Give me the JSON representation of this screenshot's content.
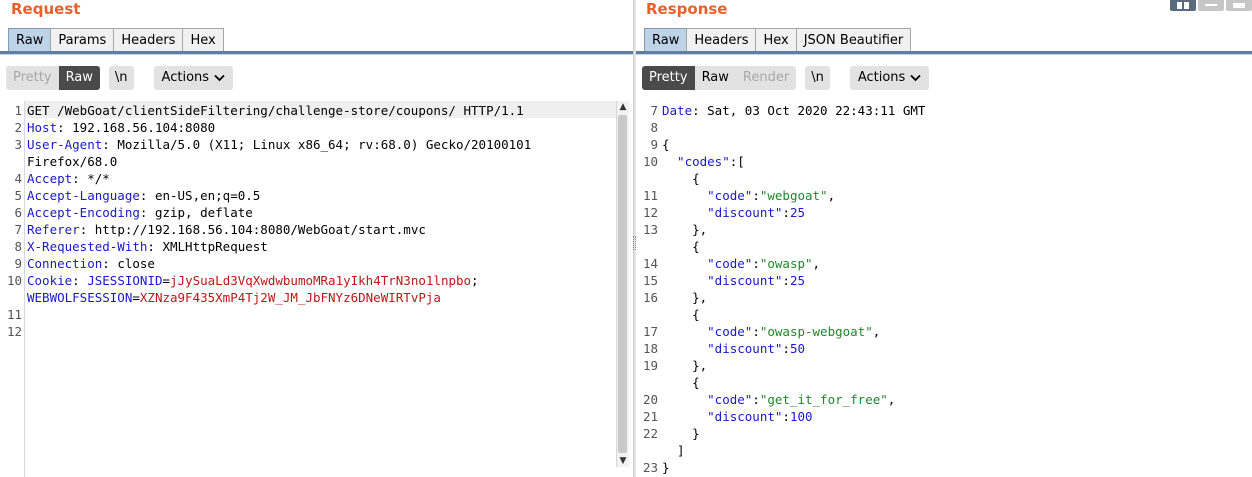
{
  "request": {
    "title": "Request",
    "tabs": [
      "Raw",
      "Params",
      "Headers",
      "Hex"
    ],
    "active_tab": "Raw",
    "view_modes": [
      "Pretty",
      "Raw"
    ],
    "newline_label": "\\n",
    "actions_label": "Actions",
    "lines": [
      {
        "n": "1",
        "parts": [
          {
            "t": "GET /WebGoat/clientSideFiltering/challenge-store/coupons/ HTTP/1.1",
            "c": ""
          }
        ]
      },
      {
        "n": "2",
        "parts": [
          {
            "t": "Host",
            "c": "k"
          },
          {
            "t": ": 192.168.56.104:8080",
            "c": ""
          }
        ]
      },
      {
        "n": "3",
        "parts": [
          {
            "t": "User-Agent",
            "c": "k"
          },
          {
            "t": ": Mozilla/5.0 (X11; Linux x86_64; rv:68.0) Gecko/20100101",
            "c": ""
          }
        ]
      },
      {
        "n": "",
        "parts": [
          {
            "t": "Firefox/68.0",
            "c": ""
          }
        ]
      },
      {
        "n": "4",
        "parts": [
          {
            "t": "Accept",
            "c": "k"
          },
          {
            "t": ": */*",
            "c": ""
          }
        ]
      },
      {
        "n": "5",
        "parts": [
          {
            "t": "Accept-Language",
            "c": "k"
          },
          {
            "t": ": en-US,en;q=0.5",
            "c": ""
          }
        ]
      },
      {
        "n": "6",
        "parts": [
          {
            "t": "Accept-Encoding",
            "c": "k"
          },
          {
            "t": ": gzip, deflate",
            "c": ""
          }
        ]
      },
      {
        "n": "7",
        "parts": [
          {
            "t": "Referer",
            "c": "k"
          },
          {
            "t": ": http://192.168.56.104:8080/WebGoat/start.mvc",
            "c": ""
          }
        ]
      },
      {
        "n": "8",
        "parts": [
          {
            "t": "X-Requested-With",
            "c": "k"
          },
          {
            "t": ": XMLHttpRequest",
            "c": ""
          }
        ]
      },
      {
        "n": "9",
        "parts": [
          {
            "t": "Connection",
            "c": "k"
          },
          {
            "t": ": close",
            "c": ""
          }
        ]
      },
      {
        "n": "10",
        "parts": [
          {
            "t": "Cookie",
            "c": "k"
          },
          {
            "t": ": ",
            "c": ""
          },
          {
            "t": "JSESSIONID",
            "c": "k"
          },
          {
            "t": "=",
            "c": ""
          },
          {
            "t": "jJySuaLd3VqXwdwbumoMRa1yIkh4TrN3no1lnpbo",
            "c": "v"
          },
          {
            "t": ";",
            "c": ""
          }
        ]
      },
      {
        "n": "",
        "parts": [
          {
            "t": "WEBWOLFSESSION",
            "c": "k"
          },
          {
            "t": "=",
            "c": ""
          },
          {
            "t": "XZNza9F435XmP4Tj2W_JM_JbFNYz6DNeWIRTvPja",
            "c": "v"
          }
        ]
      },
      {
        "n": "11",
        "parts": []
      },
      {
        "n": "12",
        "parts": []
      }
    ]
  },
  "response": {
    "title": "Response",
    "tabs": [
      "Raw",
      "Headers",
      "Hex",
      "JSON Beautifier"
    ],
    "active_tab": "Raw",
    "view_modes": [
      "Pretty",
      "Raw",
      "Render"
    ],
    "newline_label": "\\n",
    "actions_label": "Actions",
    "lines": [
      {
        "n": "7",
        "parts": [
          {
            "t": "Date",
            "c": "k"
          },
          {
            "t": ": Sat, 03 Oct 2020 22:43:11 GMT",
            "c": ""
          }
        ]
      },
      {
        "n": "8",
        "parts": []
      },
      {
        "n": "9",
        "parts": [
          {
            "t": "{",
            "c": ""
          }
        ]
      },
      {
        "n": "10",
        "parts": [
          {
            "t": "  \"codes\"",
            "c": "k"
          },
          {
            "t": ":[",
            "c": ""
          }
        ]
      },
      {
        "n": "",
        "parts": [
          {
            "t": "    {",
            "c": ""
          }
        ]
      },
      {
        "n": "11",
        "parts": [
          {
            "t": "      \"code\"",
            "c": "k"
          },
          {
            "t": ":",
            "c": ""
          },
          {
            "t": "\"webgoat\"",
            "c": "s"
          },
          {
            "t": ",",
            "c": ""
          }
        ]
      },
      {
        "n": "12",
        "parts": [
          {
            "t": "      \"discount\"",
            "c": "k"
          },
          {
            "t": ":",
            "c": ""
          },
          {
            "t": "25",
            "c": "n"
          }
        ]
      },
      {
        "n": "13",
        "parts": [
          {
            "t": "    },",
            "c": ""
          }
        ]
      },
      {
        "n": "",
        "parts": [
          {
            "t": "    {",
            "c": ""
          }
        ]
      },
      {
        "n": "14",
        "parts": [
          {
            "t": "      \"code\"",
            "c": "k"
          },
          {
            "t": ":",
            "c": ""
          },
          {
            "t": "\"owasp\"",
            "c": "s"
          },
          {
            "t": ",",
            "c": ""
          }
        ]
      },
      {
        "n": "15",
        "parts": [
          {
            "t": "      \"discount\"",
            "c": "k"
          },
          {
            "t": ":",
            "c": ""
          },
          {
            "t": "25",
            "c": "n"
          }
        ]
      },
      {
        "n": "16",
        "parts": [
          {
            "t": "    },",
            "c": ""
          }
        ]
      },
      {
        "n": "",
        "parts": [
          {
            "t": "    {",
            "c": ""
          }
        ]
      },
      {
        "n": "17",
        "parts": [
          {
            "t": "      \"code\"",
            "c": "k"
          },
          {
            "t": ":",
            "c": ""
          },
          {
            "t": "\"owasp-webgoat\"",
            "c": "s"
          },
          {
            "t": ",",
            "c": ""
          }
        ]
      },
      {
        "n": "18",
        "parts": [
          {
            "t": "      \"discount\"",
            "c": "k"
          },
          {
            "t": ":",
            "c": ""
          },
          {
            "t": "50",
            "c": "n"
          }
        ]
      },
      {
        "n": "19",
        "parts": [
          {
            "t": "    },",
            "c": ""
          }
        ]
      },
      {
        "n": "",
        "parts": [
          {
            "t": "    {",
            "c": ""
          }
        ]
      },
      {
        "n": "20",
        "parts": [
          {
            "t": "      \"code\"",
            "c": "k"
          },
          {
            "t": ":",
            "c": ""
          },
          {
            "t": "\"get_it_for_free\"",
            "c": "s"
          },
          {
            "t": ",",
            "c": ""
          }
        ]
      },
      {
        "n": "21",
        "parts": [
          {
            "t": "      \"discount\"",
            "c": "k"
          },
          {
            "t": ":",
            "c": ""
          },
          {
            "t": "100",
            "c": "n"
          }
        ]
      },
      {
        "n": "22",
        "parts": [
          {
            "t": "    }",
            "c": ""
          }
        ]
      },
      {
        "n": "",
        "parts": [
          {
            "t": "  ]",
            "c": ""
          }
        ]
      },
      {
        "n": "23",
        "parts": [
          {
            "t": "}",
            "c": ""
          }
        ]
      }
    ]
  },
  "colors": {
    "title_orange": "#e8602c",
    "key_blue": "#1a1ac6",
    "value_red": "#bb1818",
    "string_green": "#23862d",
    "active_tab": "#bcd3e8"
  },
  "icons": [
    "chevron-down-icon",
    "layout-split-icon",
    "layout-horizontal-icon",
    "layout-vertical-icon",
    "scroll-up-arrow-icon",
    "scroll-down-arrow-icon"
  ]
}
